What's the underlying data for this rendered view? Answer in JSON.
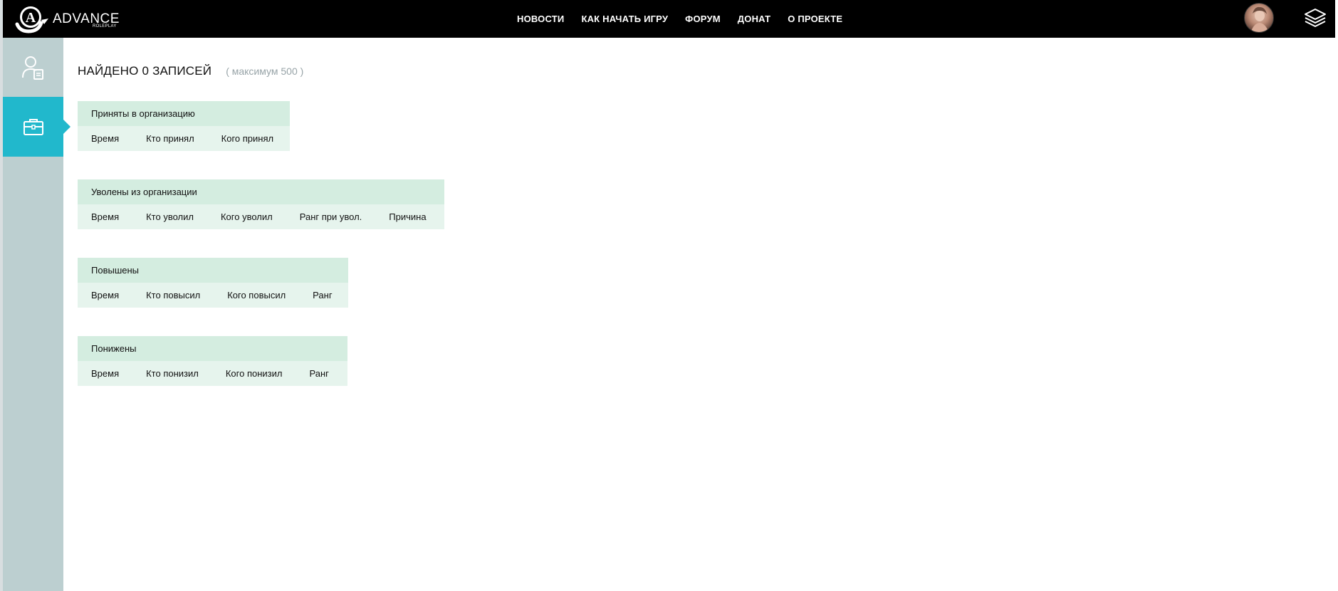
{
  "app": {
    "logo_word": "ADVANCE",
    "logo_sub": "ROLEPLAY",
    "logo_letter": "A"
  },
  "nav": {
    "items": [
      "НОВОСТИ",
      "КАК НАЧАТЬ ИГРУ",
      "ФОРУМ",
      "ДОНАТ",
      "О ПРОЕКТЕ"
    ]
  },
  "main": {
    "title": "НАЙДЕНО 0 ЗАПИСЕЙ",
    "subtitle": "( максимум 500 )",
    "sections": [
      {
        "title": "Приняты в организацию",
        "columns": [
          "Время",
          "Кто принял",
          "Кого принял"
        ]
      },
      {
        "title": "Уволены из организации",
        "columns": [
          "Время",
          "Кто уволил",
          "Кого уволил",
          "Ранг при увол.",
          "Причина"
        ]
      },
      {
        "title": "Повышены",
        "columns": [
          "Время",
          "Кто повысил",
          "Кого повысил",
          "Ранг"
        ]
      },
      {
        "title": "Понижены",
        "columns": [
          "Время",
          "Кто понизил",
          "Кого понизил",
          "Ранг"
        ]
      }
    ]
  },
  "colors": {
    "topbar": "#000000",
    "sidebar": "#bccfd0",
    "accent": "#21b8cc",
    "section_header": "#d4ede0",
    "section_row": "#e6f4ed",
    "muted_text": "#98a4a8"
  },
  "icons": {
    "sidebar_profile": "user-document-icon",
    "sidebar_active": "briefcase-icon",
    "topbar_right": "layers-icon"
  }
}
